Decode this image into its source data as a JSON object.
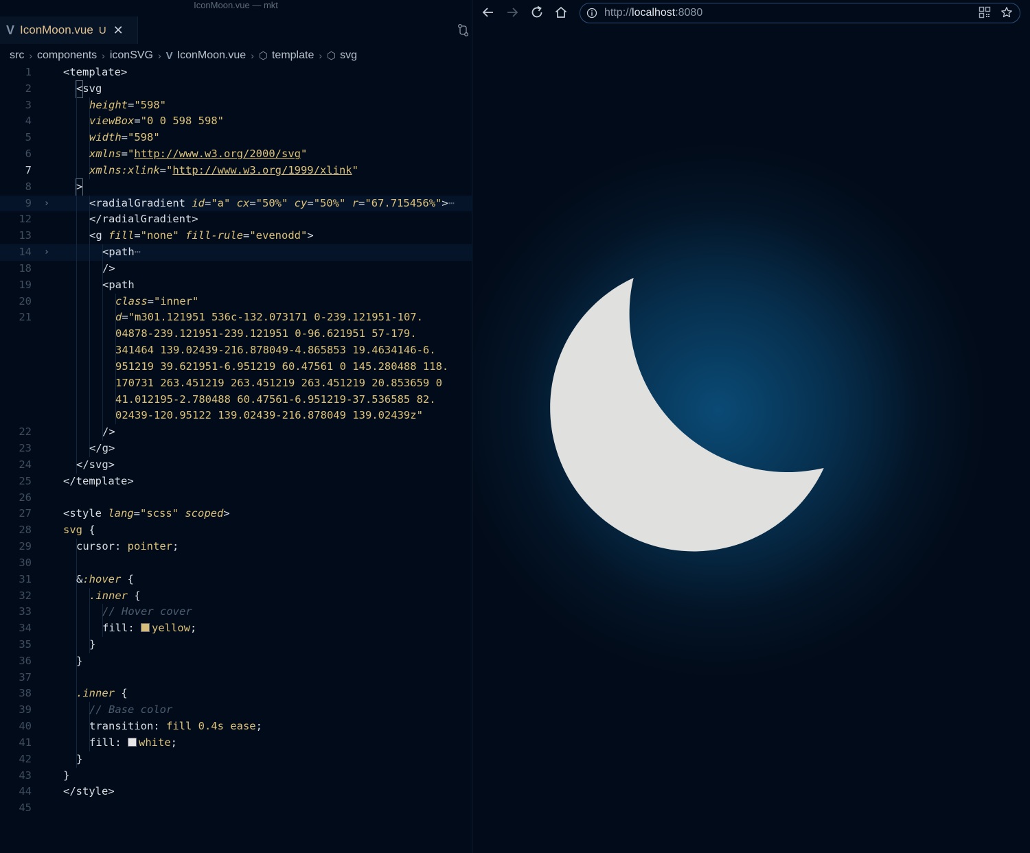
{
  "window_title": "IconMoon.vue — mkt",
  "editor": {
    "tab": {
      "logo": "V",
      "name": "IconMoon.vue",
      "status": "U",
      "close": "✕"
    },
    "breadcrumb": [
      "src",
      "components",
      "iconSVG",
      "IconMoon.vue",
      "template",
      "svg"
    ],
    "current_line": "7",
    "lines": [
      {
        "n": "1",
        "c": [
          [
            "t-tag",
            "<template>"
          ]
        ]
      },
      {
        "n": "2",
        "ind": 1,
        "c": [
          [
            "cursor",
            "<"
          ],
          [
            "t-tag",
            "svg"
          ]
        ]
      },
      {
        "n": "3",
        "ind": 2,
        "c": [
          [
            "t-attr",
            "height"
          ],
          [
            "t-tag",
            "="
          ],
          [
            "t-str",
            "\"598\""
          ]
        ]
      },
      {
        "n": "4",
        "ind": 2,
        "c": [
          [
            "t-attr",
            "viewBox"
          ],
          [
            "t-tag",
            "="
          ],
          [
            "t-str",
            "\"0 0 598 598\""
          ]
        ]
      },
      {
        "n": "5",
        "ind": 2,
        "c": [
          [
            "t-attr",
            "width"
          ],
          [
            "t-tag",
            "="
          ],
          [
            "t-str",
            "\"598\""
          ]
        ]
      },
      {
        "n": "6",
        "ind": 2,
        "c": [
          [
            "t-attr",
            "xmlns"
          ],
          [
            "t-tag",
            "="
          ],
          [
            "t-str",
            "\""
          ],
          [
            "t-str t-url",
            "http://www.w3.org/2000/svg"
          ],
          [
            "t-str",
            "\""
          ]
        ]
      },
      {
        "n": "7",
        "ind": 2,
        "c": [
          [
            "t-attr",
            "xmlns:xlink"
          ],
          [
            "t-tag",
            "="
          ],
          [
            "t-str",
            "\""
          ],
          [
            "t-str t-url",
            "http://www.w3.org/1999/xlink"
          ],
          [
            "t-str",
            "\""
          ]
        ]
      },
      {
        "n": "8",
        "ind": 1,
        "c": [
          [
            "cursor",
            ">"
          ]
        ]
      },
      {
        "n": "9",
        "ind": 2,
        "fold": true,
        "hl": true,
        "c": [
          [
            "t-tag",
            "<radialGradient "
          ],
          [
            "t-attr",
            "id"
          ],
          [
            "t-tag",
            "="
          ],
          [
            "t-str",
            "\"a\" "
          ],
          [
            "t-attr",
            "cx"
          ],
          [
            "t-tag",
            "="
          ],
          [
            "t-str",
            "\"50%\" "
          ],
          [
            "t-attr",
            "cy"
          ],
          [
            "t-tag",
            "="
          ],
          [
            "t-str",
            "\"50%\" "
          ],
          [
            "t-attr",
            "r"
          ],
          [
            "t-tag",
            "="
          ],
          [
            "t-str",
            "\"67.715456%\""
          ],
          [
            "t-tag",
            ">"
          ],
          [
            "t-dim",
            "⋯"
          ]
        ]
      },
      {
        "n": "12",
        "ind": 2,
        "c": [
          [
            "t-tag",
            "</radialGradient>"
          ]
        ]
      },
      {
        "n": "13",
        "ind": 2,
        "c": [
          [
            "t-tag",
            "<g "
          ],
          [
            "t-attr",
            "fill"
          ],
          [
            "t-tag",
            "="
          ],
          [
            "t-str",
            "\"none\" "
          ],
          [
            "t-attr",
            "fill-rule"
          ],
          [
            "t-tag",
            "="
          ],
          [
            "t-str",
            "\"evenodd\""
          ],
          [
            "t-tag",
            ">"
          ]
        ]
      },
      {
        "n": "14",
        "ind": 3,
        "fold": true,
        "hl": true,
        "c": [
          [
            "t-tag",
            "<path"
          ],
          [
            "t-dim",
            "⋯"
          ]
        ]
      },
      {
        "n": "18",
        "ind": 3,
        "c": [
          [
            "t-tag",
            "/>"
          ]
        ]
      },
      {
        "n": "19",
        "ind": 3,
        "c": [
          [
            "t-tag",
            "<path"
          ]
        ]
      },
      {
        "n": "20",
        "ind": 4,
        "c": [
          [
            "t-attr",
            "class"
          ],
          [
            "t-tag",
            "="
          ],
          [
            "t-str",
            "\"inner\""
          ]
        ]
      },
      {
        "n": "21",
        "ind": 4,
        "c": [
          [
            "t-attr",
            "d"
          ],
          [
            "t-tag",
            "="
          ],
          [
            "t-str",
            "\"m301.121951 536c-132.073171 0-239.121951-107."
          ]
        ]
      },
      {
        "n": "",
        "ind": 4,
        "c": [
          [
            "t-str",
            "04878-239.121951-239.121951 0-96.621951 57-179."
          ]
        ]
      },
      {
        "n": "",
        "ind": 4,
        "c": [
          [
            "t-str",
            "341464 139.02439-216.878049-4.865853 19.4634146-6."
          ]
        ]
      },
      {
        "n": "",
        "ind": 4,
        "c": [
          [
            "t-str",
            "951219 39.621951-6.951219 60.47561 0 145.280488 118."
          ]
        ]
      },
      {
        "n": "",
        "ind": 4,
        "c": [
          [
            "t-str",
            "170731 263.451219 263.451219 263.451219 20.853659 0"
          ]
        ]
      },
      {
        "n": "",
        "ind": 4,
        "c": [
          [
            "t-str",
            "41.012195-2.780488 60.47561-6.951219-37.536585 82."
          ]
        ]
      },
      {
        "n": "",
        "ind": 4,
        "c": [
          [
            "t-str",
            "02439-120.95122 139.02439-216.878049 139.02439z\""
          ]
        ]
      },
      {
        "n": "22",
        "ind": 3,
        "c": [
          [
            "t-tag",
            "/>"
          ]
        ]
      },
      {
        "n": "23",
        "ind": 2,
        "c": [
          [
            "t-tag",
            "</g>"
          ]
        ]
      },
      {
        "n": "24",
        "ind": 1,
        "c": [
          [
            "t-tag",
            "</svg>"
          ]
        ]
      },
      {
        "n": "25",
        "c": [
          [
            "t-tag",
            "</template>"
          ]
        ]
      },
      {
        "n": "26",
        "c": []
      },
      {
        "n": "27",
        "c": [
          [
            "t-tag",
            "<style "
          ],
          [
            "t-attr",
            "lang"
          ],
          [
            "t-tag",
            "="
          ],
          [
            "t-str",
            "\"scss\" "
          ],
          [
            "t-attr",
            "scoped"
          ],
          [
            "t-tag",
            ">"
          ]
        ]
      },
      {
        "n": "28",
        "c": [
          [
            "t-kw",
            "svg"
          ],
          [
            "t-plain",
            " {"
          ]
        ]
      },
      {
        "n": "29",
        "ind": 1,
        "c": [
          [
            "t-plain",
            "cursor"
          ],
          [
            "t-plain",
            ": "
          ],
          [
            "t-kw",
            "pointer"
          ],
          [
            "t-plain",
            ";"
          ]
        ]
      },
      {
        "n": "30",
        "ind": 1,
        "c": []
      },
      {
        "n": "31",
        "ind": 1,
        "c": [
          [
            "t-plain",
            "&"
          ],
          [
            "t-attr",
            ":hover"
          ],
          [
            "t-plain",
            " {"
          ]
        ]
      },
      {
        "n": "32",
        "ind": 2,
        "c": [
          [
            "t-attr",
            ".inner"
          ],
          [
            "t-plain",
            " {"
          ]
        ]
      },
      {
        "n": "33",
        "ind": 3,
        "c": [
          [
            "t-com",
            "// Hover cover"
          ]
        ]
      },
      {
        "n": "34",
        "ind": 3,
        "c": [
          [
            "t-plain",
            "fill: "
          ],
          [
            "swatch",
            "#d6bd7a"
          ],
          [
            "t-kw",
            "yellow"
          ],
          [
            "t-plain",
            ";"
          ]
        ]
      },
      {
        "n": "35",
        "ind": 2,
        "c": [
          [
            "t-plain",
            "}"
          ]
        ]
      },
      {
        "n": "36",
        "ind": 1,
        "c": [
          [
            "t-plain",
            "}"
          ]
        ]
      },
      {
        "n": "37",
        "ind": 1,
        "c": []
      },
      {
        "n": "38",
        "ind": 1,
        "c": [
          [
            "t-attr",
            ".inner"
          ],
          [
            "t-plain",
            " {"
          ]
        ]
      },
      {
        "n": "39",
        "ind": 2,
        "c": [
          [
            "t-com",
            "// Base color"
          ]
        ]
      },
      {
        "n": "40",
        "ind": 2,
        "c": [
          [
            "t-plain",
            "transition: "
          ],
          [
            "t-kw",
            "fill 0.4s ease"
          ],
          [
            "t-plain",
            ";"
          ]
        ]
      },
      {
        "n": "41",
        "ind": 2,
        "c": [
          [
            "t-plain",
            "fill: "
          ],
          [
            "swatch",
            "#e8e8e8"
          ],
          [
            "t-kw",
            "white"
          ],
          [
            "t-plain",
            ";"
          ]
        ]
      },
      {
        "n": "42",
        "ind": 1,
        "c": [
          [
            "t-plain",
            "}"
          ]
        ]
      },
      {
        "n": "43",
        "c": [
          [
            "t-plain",
            "}"
          ]
        ]
      },
      {
        "n": "44",
        "c": [
          [
            "t-tag",
            "</style>"
          ]
        ]
      },
      {
        "n": "45",
        "c": []
      }
    ]
  },
  "browser": {
    "url_scheme": "http://",
    "url_host": "localhost",
    "url_port": ":8080",
    "icons": [
      "back-icon",
      "forward-icon",
      "reload-icon",
      "home-icon",
      "info-icon",
      "qr-code-icon",
      "star-icon"
    ],
    "moon_fill": "#e0e0df",
    "glow_color": "#0a4a75",
    "background": "#020b19"
  }
}
